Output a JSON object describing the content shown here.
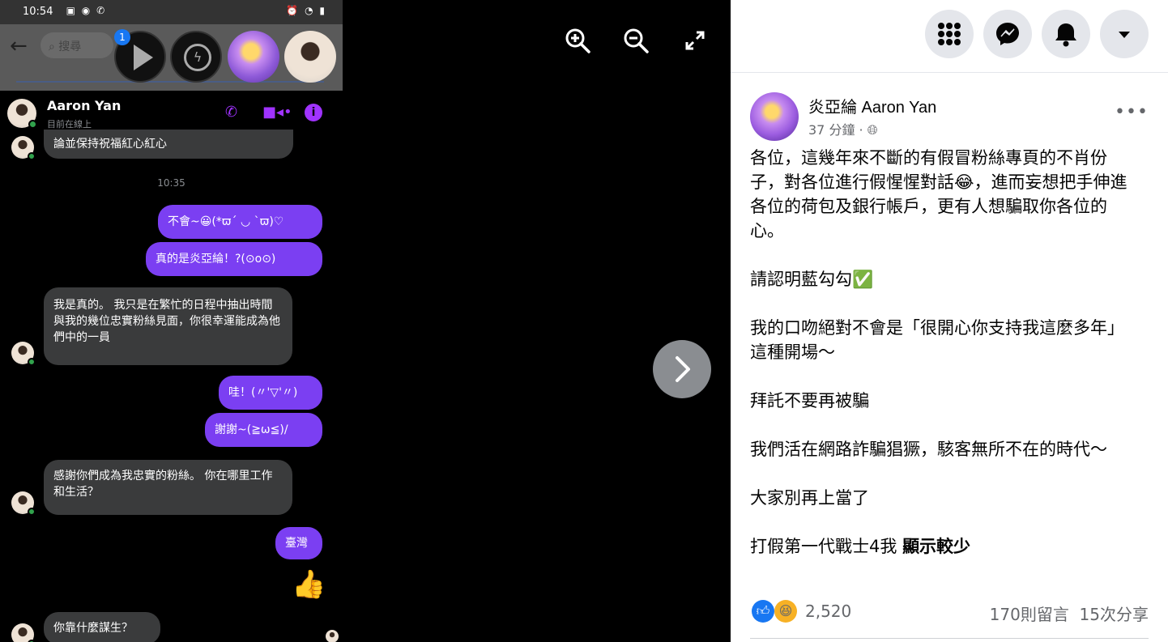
{
  "phone": {
    "status_time": "10:54",
    "search_placeholder": "搜尋",
    "badge_count": "1",
    "contact_name": "Aaron Yan",
    "contact_status": "目前在線上",
    "messages": {
      "m0": "論並保持祝福紅心紅心",
      "timestamp": "10:35",
      "m1": "不會~😀(*ϖ´ ◡ `ϖ)♡",
      "m2": "真的是炎亞綸！?(⊙o⊙)",
      "m3": "我是真的。 我只是在繁忙的日程中抽出時間與我的幾位忠實粉絲見面，你很幸運能成為他們中的一員",
      "m4": "哇！(〃'▽'〃)",
      "m5": "謝謝~(≧ω≦)/",
      "m6": "感謝你們成為我忠實的粉絲。 你在哪里工作和生活？",
      "m7": "臺灣",
      "m8": "你靠什麼謀生？"
    }
  },
  "viewer": {
    "zoom_in_icon": "zoom-in-icon",
    "zoom_out_icon": "zoom-out-icon",
    "fullscreen_icon": "expand-icon",
    "next_icon": "chevron-right-icon"
  },
  "post": {
    "author": "炎亞綸 Aaron Yan",
    "time": "37 分鐘 ·",
    "paragraphs": {
      "p1": "各位，這幾年來不斷的有假冒粉絲專頁的不肖份子，對各位進行假惺惺對話😂，進而妄想把手伸進各位的荷包及銀行帳戶，更有人想騙取你各位的心。",
      "p2": "請認明藍勾勾✅",
      "p3": "我的口吻絕對不會是「很開心你支持我這麼多年」這種開場～",
      "p4": "拜託不要再被騙",
      "p5": "我們活在網路詐騙猖獗，駭客無所不在的時代～",
      "p6": "大家別再上當了",
      "p7": "打假第一代戰士4我",
      "see_less": "顯示較少"
    },
    "reactions_count": "2,520",
    "comments": "170則留言",
    "shares": "15次分享"
  },
  "colors": {
    "messenger_out": "#7b3ff2",
    "messenger_in": "#3a3b3c",
    "fb_gray": "#e4e6eb",
    "fb_blue": "#1877f2"
  }
}
